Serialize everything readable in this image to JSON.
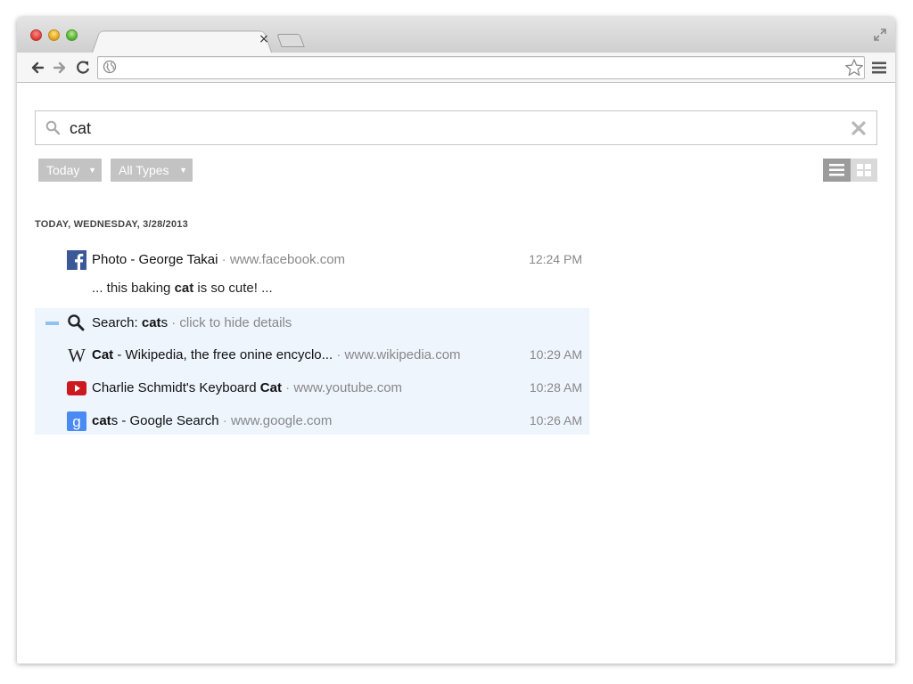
{
  "browser": {
    "tab_close": "×",
    "icons": {
      "back": "back-arrow-icon",
      "forward": "forward-arrow-icon",
      "reload": "reload-icon",
      "globe": "globe-icon",
      "star": "star-icon",
      "menu": "hamburger-menu-icon",
      "fullscreen": "fullscreen-icon"
    },
    "address_value": ""
  },
  "history": {
    "search_value": "cat",
    "filters": {
      "date_label": "Today",
      "type_label": "All Types"
    },
    "date_header": "TODAY, WEDNESDAY, 3/28/2013",
    "entries": [
      {
        "icon": "facebook-icon",
        "title": "Photo - George Takai",
        "url": "www.facebook.com",
        "time": "12:24 PM",
        "snippet_pre": "... this baking ",
        "snippet_bold": "cat",
        "snippet_post": " is so cute! ..."
      }
    ],
    "group": {
      "label_prefix": "Search: ",
      "label_bold": "cat",
      "label_rest": "s",
      "details": "click to hide details",
      "items": [
        {
          "icon": "wikipedia-icon",
          "title_bold": "Cat",
          "title_rest": " - Wikipedia, the free onine encyclo...",
          "url": "www.wikipedia.com",
          "time": "10:29 AM"
        },
        {
          "icon": "youtube-icon",
          "title_pre": "Charlie Schmidt's Keyboard ",
          "title_bold": "Cat",
          "url": "www.youtube.com",
          "time": "10:28 AM"
        },
        {
          "icon": "google-icon",
          "title_bold": "cat",
          "title_rest": "s - Google Search",
          "url": "www.google.com",
          "time": "10:26 AM"
        }
      ]
    },
    "separator": "·",
    "colors": {
      "group_background": "#eef5fd",
      "group_dash": "#8fc2ee",
      "filter_background": "#c3c3c3",
      "facebook": "#3b5998",
      "youtube": "#cc181e",
      "google": "#4a8af4"
    }
  }
}
